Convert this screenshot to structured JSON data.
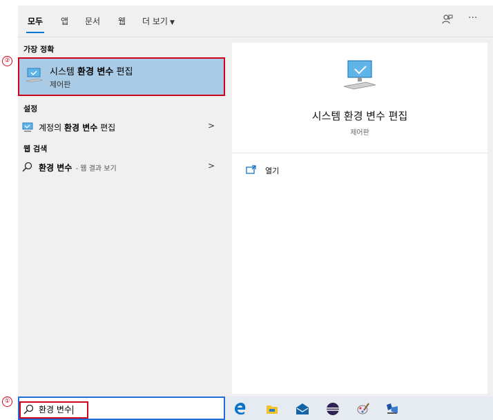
{
  "annotations": {
    "marker_1": "①",
    "marker_2": "②"
  },
  "tabs": [
    {
      "label": "모두",
      "active": true
    },
    {
      "label": "앱"
    },
    {
      "label": "문서"
    },
    {
      "label": "웹"
    },
    {
      "label": "더 보기"
    }
  ],
  "top_icons": {
    "feedback": "feedback-icon",
    "more": "···"
  },
  "left": {
    "best_match_heading": "가장 정확",
    "best_match": {
      "title_prefix": "시스템 ",
      "title_bold": "환경 변수",
      "title_suffix": " 편집",
      "subtitle": "제어판"
    },
    "settings_heading": "설정",
    "settings_item": {
      "prefix": "계정의 ",
      "bold": "환경 변수",
      "suffix": " 편집"
    },
    "web_heading": "웹 검색",
    "web_item": {
      "bold": "환경 변수",
      "suffix": " - 웹 결과 보기"
    }
  },
  "detail": {
    "title": "시스템 환경 변수 편집",
    "subtitle": "제어판",
    "open_label": "열기"
  },
  "search": {
    "value": "환경 변수"
  },
  "taskbar": {
    "icons": [
      "edge-icon",
      "file-explorer-icon",
      "mail-icon",
      "eclipse-icon",
      "paint-icon",
      "app-icon"
    ]
  },
  "colors": {
    "accent": "#0078d7",
    "selection": "#a9cbe6",
    "annotation": "#d0021b"
  }
}
